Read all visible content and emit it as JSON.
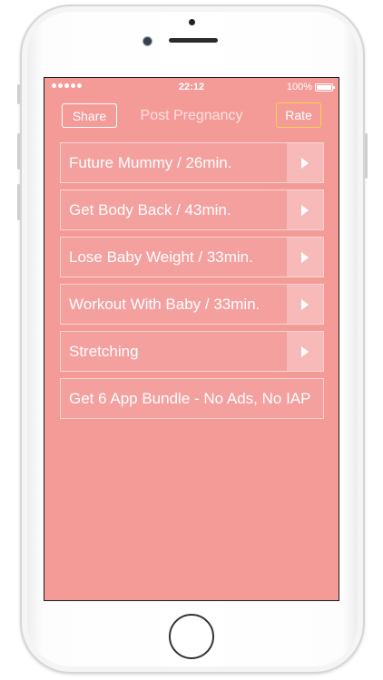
{
  "status_bar": {
    "time": "22:12",
    "battery": "100%"
  },
  "nav": {
    "share_label": "Share",
    "title": "Post Pregnancy",
    "rate_label": "Rate"
  },
  "workouts": [
    {
      "label": "Future Mummy / 26min.",
      "icon": "play-icon"
    },
    {
      "label": "Get Body Back / 43min.",
      "icon": "play-icon"
    },
    {
      "label": "Lose Baby Weight / 33min.",
      "icon": "play-icon"
    },
    {
      "label": "Workout With Baby / 33min.",
      "icon": "play-icon"
    },
    {
      "label": "Stretching",
      "icon": "play-icon"
    }
  ],
  "bundle": {
    "label": "Get 6 App Bundle - No Ads, No IAP"
  },
  "colors": {
    "screen_background": "#f49b98",
    "rate_border": "#f7d24a",
    "text": "#ffffff"
  }
}
